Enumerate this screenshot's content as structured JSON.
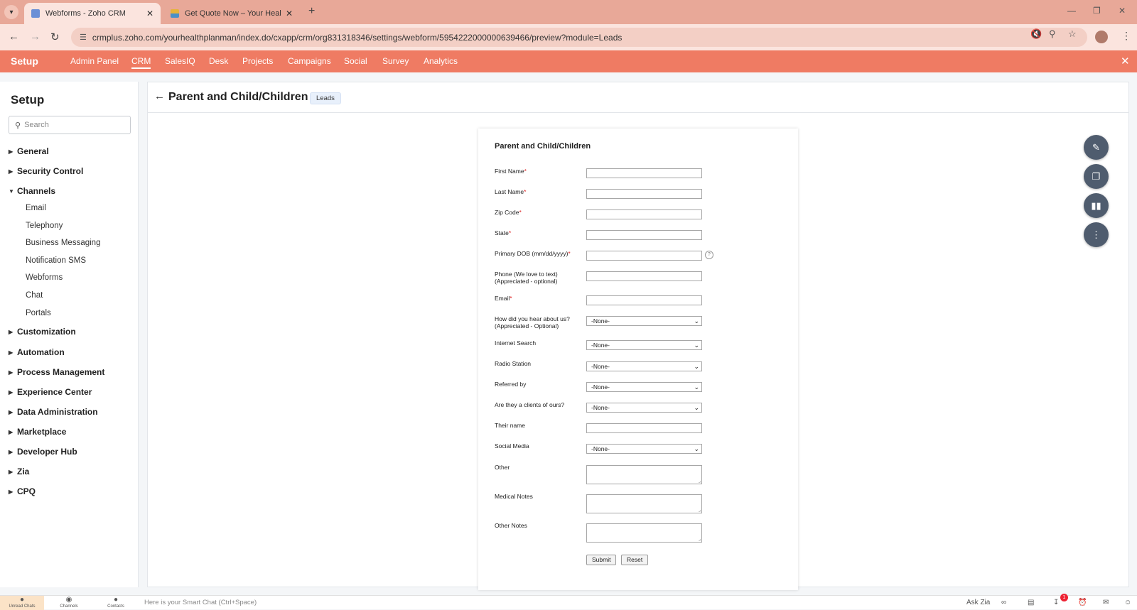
{
  "browser": {
    "tabs": [
      {
        "title": "Webforms - Zoho CRM",
        "active": true
      },
      {
        "title": "Get Quote Now – Your Health P",
        "active": false
      }
    ],
    "url": "crmplus.zoho.com/yourhealthplanman/index.do/cxapp/crm/org831318346/settings/webform/5954222000000639466/preview?module=Leads"
  },
  "topnav": {
    "brand": "Setup",
    "items": [
      "Admin Panel",
      "CRM",
      "SalesIQ",
      "Desk",
      "Projects",
      "Campaigns",
      "Social",
      "Survey",
      "Analytics"
    ],
    "active": "CRM"
  },
  "sidebar": {
    "title": "Setup",
    "search_placeholder": "Search",
    "sections": [
      {
        "label": "General",
        "expanded": false
      },
      {
        "label": "Security Control",
        "expanded": false
      },
      {
        "label": "Channels",
        "expanded": true,
        "children": [
          "Email",
          "Telephony",
          "Business Messaging",
          "Notification SMS",
          "Webforms",
          "Chat",
          "Portals"
        ]
      },
      {
        "label": "Customization",
        "expanded": false
      },
      {
        "label": "Automation",
        "expanded": false
      },
      {
        "label": "Process Management",
        "expanded": false
      },
      {
        "label": "Experience Center",
        "expanded": false
      },
      {
        "label": "Data Administration",
        "expanded": false
      },
      {
        "label": "Marketplace",
        "expanded": false
      },
      {
        "label": "Developer Hub",
        "expanded": false
      },
      {
        "label": "Zia",
        "expanded": false
      },
      {
        "label": "CPQ",
        "expanded": false
      }
    ]
  },
  "main": {
    "title": "Parent and Child/Children",
    "module_badge": "Leads"
  },
  "form": {
    "title": "Parent and Child/Children",
    "fields": [
      {
        "label": "First Name",
        "required": true,
        "type": "text"
      },
      {
        "label": "Last Name",
        "required": true,
        "type": "text"
      },
      {
        "label": "Zip Code",
        "required": true,
        "type": "text"
      },
      {
        "label": "State",
        "required": true,
        "type": "text"
      },
      {
        "label": "Primary DOB (mm/dd/yyyy)",
        "required": true,
        "type": "text",
        "help": true
      },
      {
        "label": "Phone (We love to text) (Appreciated - optional)",
        "required": false,
        "type": "text"
      },
      {
        "label": "Email",
        "required": true,
        "type": "text"
      },
      {
        "label": "How did you hear about us? (Appreciated - Optional)",
        "required": false,
        "type": "select",
        "value": "-None-"
      },
      {
        "label": "Internet Search",
        "required": false,
        "type": "select",
        "value": "-None-"
      },
      {
        "label": "Radio Station",
        "required": false,
        "type": "select",
        "value": "-None-"
      },
      {
        "label": "Referred by",
        "required": false,
        "type": "select",
        "value": "-None-"
      },
      {
        "label": "Are they a clients of ours?",
        "required": false,
        "type": "select",
        "value": "-None-"
      },
      {
        "label": "Their name",
        "required": false,
        "type": "text"
      },
      {
        "label": "Social Media",
        "required": false,
        "type": "select",
        "value": "-None-"
      },
      {
        "label": "Other",
        "required": false,
        "type": "textarea"
      },
      {
        "label": "Medical Notes",
        "required": false,
        "type": "textarea"
      },
      {
        "label": "Other Notes",
        "required": false,
        "type": "textarea"
      }
    ],
    "submit_label": "Submit",
    "reset_label": "Reset",
    "required_mark": "*"
  },
  "fabs": [
    "edit-icon",
    "copy-icon",
    "chart-icon",
    "more-icon"
  ],
  "bottombar": {
    "tabs": [
      "Unread Chats",
      "Channels",
      "Contacts"
    ],
    "smartchat_placeholder": "Here is your Smart Chat (Ctrl+Space)",
    "ask_zia": "Ask Zia",
    "notification_count": "1"
  },
  "colors": {
    "topnav": "#ef7b63",
    "tabbar": "#e8a898",
    "fab": "#4f5c6e"
  }
}
